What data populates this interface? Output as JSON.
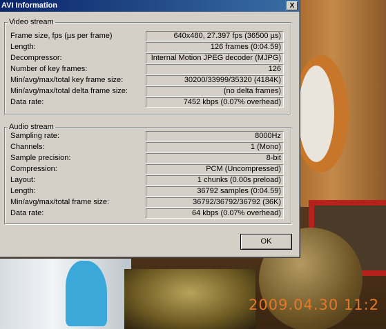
{
  "window": {
    "title": "AVI Information",
    "close_glyph": "X"
  },
  "video": {
    "legend": "Video stream",
    "rows": [
      {
        "label": "Frame size, fps (µs per frame)",
        "value": "640x480, 27.397 fps (36500 µs)"
      },
      {
        "label": "Length:",
        "value": "126 frames (0:04.59)"
      },
      {
        "label": "Decompressor:",
        "value": "Internal Motion JPEG decoder (MJPG)"
      },
      {
        "label": "Number of key frames:",
        "value": "126"
      },
      {
        "label": "Min/avg/max/total key frame size:",
        "value": "30200/33999/35320 (4184K)"
      },
      {
        "label": "Min/avg/max/total delta frame size:",
        "value": "(no delta frames)"
      },
      {
        "label": "Data rate:",
        "value": "7452 kbps (0.07% overhead)"
      }
    ]
  },
  "audio": {
    "legend": "Audio stream",
    "rows": [
      {
        "label": "Sampling rate:",
        "value": "8000Hz"
      },
      {
        "label": "Channels:",
        "value": "1 (Mono)"
      },
      {
        "label": "Sample precision:",
        "value": "8-bit"
      },
      {
        "label": "Compression:",
        "value": "PCM (Uncompressed)"
      },
      {
        "label": "Layout:",
        "value": "1 chunks (0.00s preload)"
      },
      {
        "label": "Length:",
        "value": "36792 samples (0:04.59)"
      },
      {
        "label": "Min/avg/max/total frame size:",
        "value": "36792/36792/36792 (36K)"
      },
      {
        "label": "Data rate:",
        "value": "64 kbps (0.07% overhead)"
      }
    ]
  },
  "ok_label": "OK",
  "background": {
    "timestamp": "2009.04.30 11:2"
  }
}
